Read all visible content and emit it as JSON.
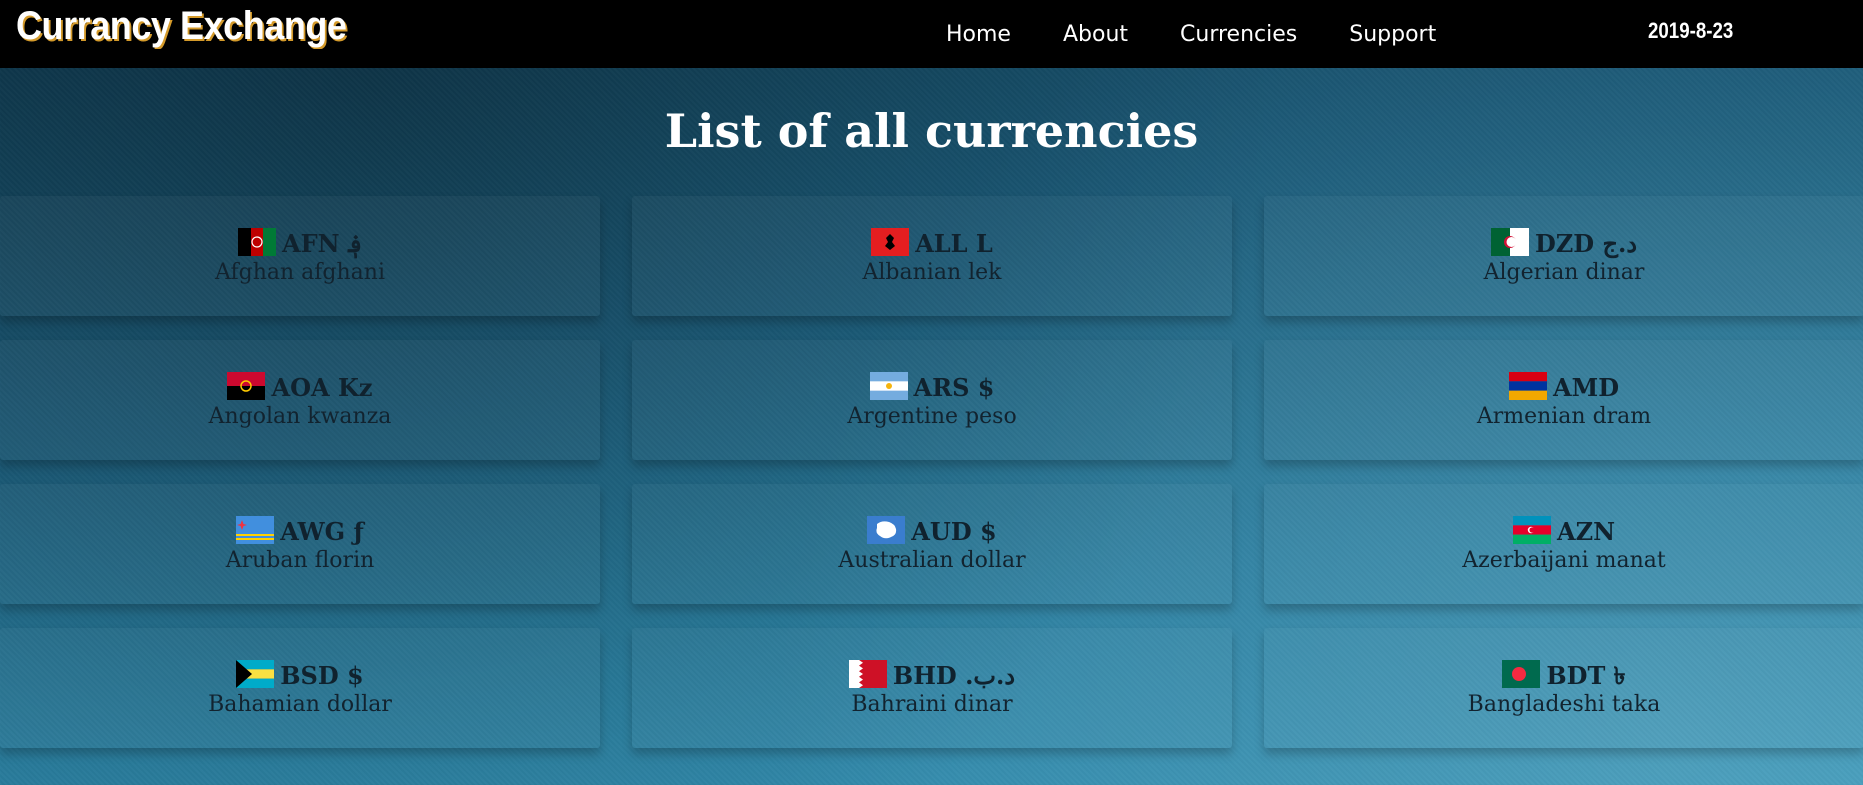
{
  "brand": "Currancy Exchange",
  "nav": {
    "links": [
      "Home",
      "About",
      "Currencies",
      "Support"
    ],
    "date": "2019-8-23"
  },
  "page": {
    "title": "List of all currencies"
  },
  "currencies": [
    {
      "code": "AFN",
      "symbol": "؋",
      "name": "Afghan afghani",
      "flag": "afghanistan-flag-icon"
    },
    {
      "code": "ALL",
      "symbol": "L",
      "name": "Albanian lek",
      "flag": "albania-flag-icon"
    },
    {
      "code": "DZD",
      "symbol": "د.ج",
      "name": "Algerian dinar",
      "flag": "algeria-flag-icon"
    },
    {
      "code": "AOA",
      "symbol": "Kz",
      "name": "Angolan kwanza",
      "flag": "angola-flag-icon"
    },
    {
      "code": "ARS",
      "symbol": "$",
      "name": "Argentine peso",
      "flag": "argentina-flag-icon"
    },
    {
      "code": "AMD",
      "symbol": "",
      "name": "Armenian dram",
      "flag": "armenia-flag-icon"
    },
    {
      "code": "AWG",
      "symbol": "ƒ",
      "name": "Aruban florin",
      "flag": "aruba-flag-icon"
    },
    {
      "code": "AUD",
      "symbol": "$",
      "name": "Australian dollar",
      "flag": "antarctica-flag-icon"
    },
    {
      "code": "AZN",
      "symbol": "",
      "name": "Azerbaijani manat",
      "flag": "azerbaijan-flag-icon"
    },
    {
      "code": "BSD",
      "symbol": "$",
      "name": "Bahamian dollar",
      "flag": "bahamas-flag-icon"
    },
    {
      "code": "BHD",
      "symbol": ".د.ب",
      "name": "Bahraini dinar",
      "flag": "bahrain-flag-icon"
    },
    {
      "code": "BDT",
      "symbol": "৳",
      "name": "Bangladeshi taka",
      "flag": "bangladesh-flag-icon"
    }
  ]
}
